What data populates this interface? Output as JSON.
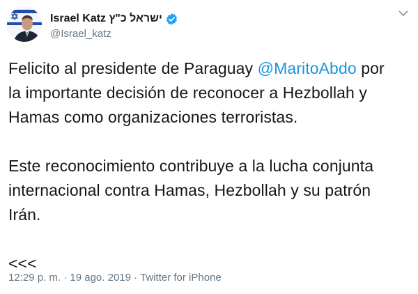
{
  "author": {
    "display_name": "Israel Katz ישראל כ\"ץ",
    "handle": "@Israel_katz",
    "verified": true,
    "avatar_icon": "profile-photo-with-israel-flag"
  },
  "tweet": {
    "paragraph1_before": "Felicito al presidente de Paraguay ",
    "mention": "@MaritoAbdo",
    "paragraph1_line1_after": " por",
    "paragraph1_line2": "la importante decisión de reconocer a Hezbollah y",
    "paragraph1_line3": "Hamas como organizaciones terroristas.",
    "paragraph2_line1": "Este reconocimiento contribuye a la lucha conjunta",
    "paragraph2_line2": "internacional contra Hamas, Hezbollah y su patrón",
    "paragraph2_line3": "Irán.",
    "closing": "<<<"
  },
  "meta": {
    "time": "12:29 p. m.",
    "separator1": " · ",
    "date": "19 ago. 2019",
    "separator2": " · ",
    "source": "Twitter for iPhone"
  },
  "colors": {
    "text": "#14171a",
    "secondary": "#657786",
    "link": "#1b95e0",
    "verified_badge": "#1da1f2"
  }
}
